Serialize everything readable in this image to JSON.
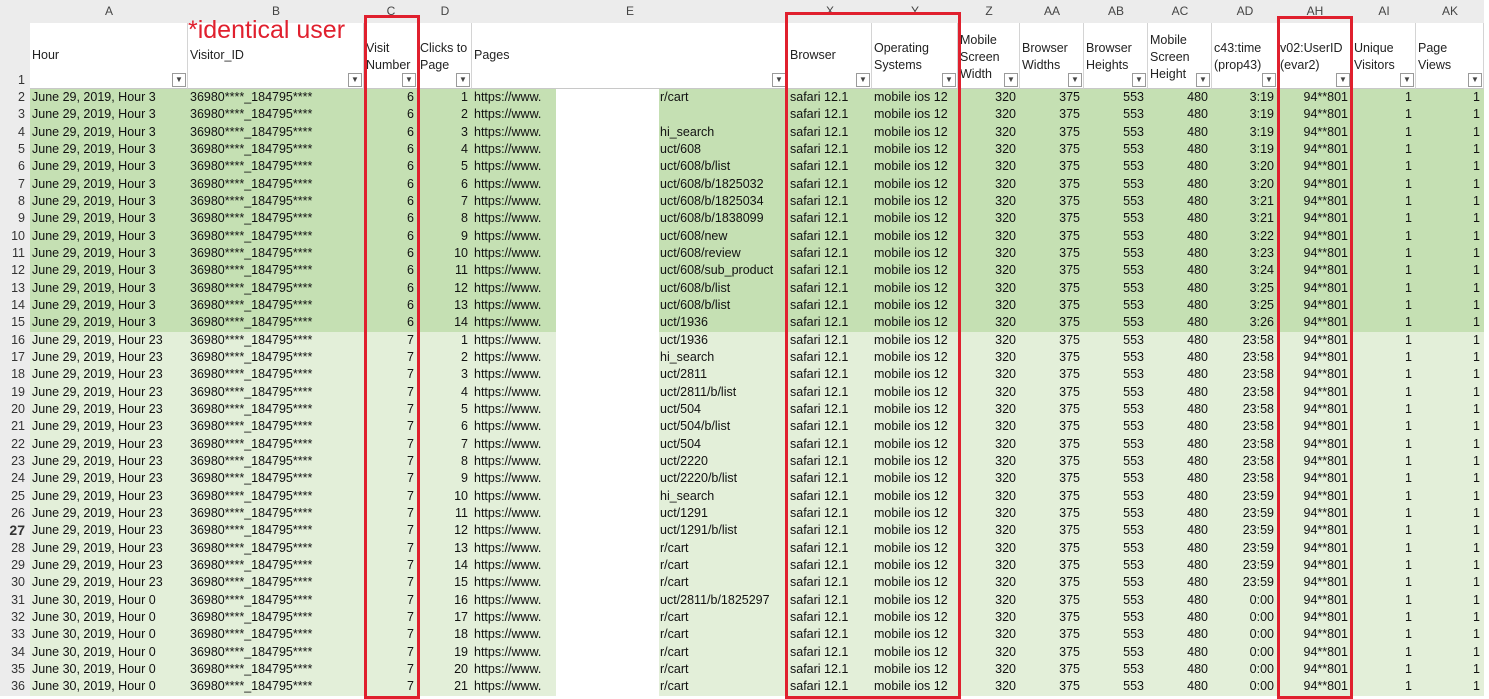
{
  "sheet": {
    "column_letters": [
      "A",
      "B",
      "C",
      "D",
      "E",
      "X",
      "Y",
      "Z",
      "AA",
      "AB",
      "AC",
      "AD",
      "AH",
      "AI",
      "AK"
    ],
    "headers": {
      "A": "Hour",
      "B": "Visitor_ID",
      "C": "Visit Number",
      "D": "Clicks to Page",
      "E": "Pages",
      "X": "Browser",
      "Y": "Operating Systems",
      "Z": "Mobile Screen Width",
      "AA": "Browser Widths",
      "AB": "Browser Heights",
      "AC": "Mobile Screen Height",
      "AD": "c43:time (prop43)",
      "AH": "v02:UserID (evar2)",
      "AI": "Unique Visitors",
      "AK": "Page Views"
    },
    "header_row_number": "1",
    "rows": [
      {
        "n": "2",
        "hour": "June 29, 2019, Hour 3",
        "visitor": "36980****_184795****",
        "visit": "6",
        "clicks": "1",
        "page_left": "https://www.",
        "page_right": "r/cart",
        "browser": "safari 12.1",
        "os": "mobile ios 12",
        "msw": "320",
        "bw": "375",
        "bh": "553",
        "msh": "480",
        "time": "3:19",
        "userid": "94**801",
        "uv": "1",
        "pv": "1"
      },
      {
        "n": "3",
        "hour": "June 29, 2019, Hour 3",
        "visitor": "36980****_184795****",
        "visit": "6",
        "clicks": "2",
        "page_left": "https://www.",
        "page_right": "",
        "browser": "safari 12.1",
        "os": "mobile ios 12",
        "msw": "320",
        "bw": "375",
        "bh": "553",
        "msh": "480",
        "time": "3:19",
        "userid": "94**801",
        "uv": "1",
        "pv": "1"
      },
      {
        "n": "4",
        "hour": "June 29, 2019, Hour 3",
        "visitor": "36980****_184795****",
        "visit": "6",
        "clicks": "3",
        "page_left": "https://www.",
        "page_right": "hi_search",
        "browser": "safari 12.1",
        "os": "mobile ios 12",
        "msw": "320",
        "bw": "375",
        "bh": "553",
        "msh": "480",
        "time": "3:19",
        "userid": "94**801",
        "uv": "1",
        "pv": "1"
      },
      {
        "n": "5",
        "hour": "June 29, 2019, Hour 3",
        "visitor": "36980****_184795****",
        "visit": "6",
        "clicks": "4",
        "page_left": "https://www.",
        "page_right": "uct/608",
        "browser": "safari 12.1",
        "os": "mobile ios 12",
        "msw": "320",
        "bw": "375",
        "bh": "553",
        "msh": "480",
        "time": "3:19",
        "userid": "94**801",
        "uv": "1",
        "pv": "1"
      },
      {
        "n": "6",
        "hour": "June 29, 2019, Hour 3",
        "visitor": "36980****_184795****",
        "visit": "6",
        "clicks": "5",
        "page_left": "https://www.",
        "page_right": "uct/608/b/list",
        "browser": "safari 12.1",
        "os": "mobile ios 12",
        "msw": "320",
        "bw": "375",
        "bh": "553",
        "msh": "480",
        "time": "3:20",
        "userid": "94**801",
        "uv": "1",
        "pv": "1"
      },
      {
        "n": "7",
        "hour": "June 29, 2019, Hour 3",
        "visitor": "36980****_184795****",
        "visit": "6",
        "clicks": "6",
        "page_left": "https://www.",
        "page_right": "uct/608/b/1825032",
        "browser": "safari 12.1",
        "os": "mobile ios 12",
        "msw": "320",
        "bw": "375",
        "bh": "553",
        "msh": "480",
        "time": "3:20",
        "userid": "94**801",
        "uv": "1",
        "pv": "1"
      },
      {
        "n": "8",
        "hour": "June 29, 2019, Hour 3",
        "visitor": "36980****_184795****",
        "visit": "6",
        "clicks": "7",
        "page_left": "https://www.",
        "page_right": "uct/608/b/1825034",
        "browser": "safari 12.1",
        "os": "mobile ios 12",
        "msw": "320",
        "bw": "375",
        "bh": "553",
        "msh": "480",
        "time": "3:21",
        "userid": "94**801",
        "uv": "1",
        "pv": "1"
      },
      {
        "n": "9",
        "hour": "June 29, 2019, Hour 3",
        "visitor": "36980****_184795****",
        "visit": "6",
        "clicks": "8",
        "page_left": "https://www.",
        "page_right": "uct/608/b/1838099",
        "browser": "safari 12.1",
        "os": "mobile ios 12",
        "msw": "320",
        "bw": "375",
        "bh": "553",
        "msh": "480",
        "time": "3:21",
        "userid": "94**801",
        "uv": "1",
        "pv": "1"
      },
      {
        "n": "10",
        "hour": "June 29, 2019, Hour 3",
        "visitor": "36980****_184795****",
        "visit": "6",
        "clicks": "9",
        "page_left": "https://www.",
        "page_right": "uct/608/new",
        "browser": "safari 12.1",
        "os": "mobile ios 12",
        "msw": "320",
        "bw": "375",
        "bh": "553",
        "msh": "480",
        "time": "3:22",
        "userid": "94**801",
        "uv": "1",
        "pv": "1"
      },
      {
        "n": "11",
        "hour": "June 29, 2019, Hour 3",
        "visitor": "36980****_184795****",
        "visit": "6",
        "clicks": "10",
        "page_left": "https://www.",
        "page_right": "uct/608/review",
        "browser": "safari 12.1",
        "os": "mobile ios 12",
        "msw": "320",
        "bw": "375",
        "bh": "553",
        "msh": "480",
        "time": "3:23",
        "userid": "94**801",
        "uv": "1",
        "pv": "1"
      },
      {
        "n": "12",
        "hour": "June 29, 2019, Hour 3",
        "visitor": "36980****_184795****",
        "visit": "6",
        "clicks": "11",
        "page_left": "https://www.",
        "page_right": "uct/608/sub_product",
        "browser": "safari 12.1",
        "os": "mobile ios 12",
        "msw": "320",
        "bw": "375",
        "bh": "553",
        "msh": "480",
        "time": "3:24",
        "userid": "94**801",
        "uv": "1",
        "pv": "1"
      },
      {
        "n": "13",
        "hour": "June 29, 2019, Hour 3",
        "visitor": "36980****_184795****",
        "visit": "6",
        "clicks": "12",
        "page_left": "https://www.",
        "page_right": "uct/608/b/list",
        "browser": "safari 12.1",
        "os": "mobile ios 12",
        "msw": "320",
        "bw": "375",
        "bh": "553",
        "msh": "480",
        "time": "3:25",
        "userid": "94**801",
        "uv": "1",
        "pv": "1"
      },
      {
        "n": "14",
        "hour": "June 29, 2019, Hour 3",
        "visitor": "36980****_184795****",
        "visit": "6",
        "clicks": "13",
        "page_left": "https://www.",
        "page_right": "uct/608/b/list",
        "browser": "safari 12.1",
        "os": "mobile ios 12",
        "msw": "320",
        "bw": "375",
        "bh": "553",
        "msh": "480",
        "time": "3:25",
        "userid": "94**801",
        "uv": "1",
        "pv": "1"
      },
      {
        "n": "15",
        "hour": "June 29, 2019, Hour 3",
        "visitor": "36980****_184795****",
        "visit": "6",
        "clicks": "14",
        "page_left": "https://www.",
        "page_right": "uct/1936",
        "browser": "safari 12.1",
        "os": "mobile ios 12",
        "msw": "320",
        "bw": "375",
        "bh": "553",
        "msh": "480",
        "time": "3:26",
        "userid": "94**801",
        "uv": "1",
        "pv": "1"
      },
      {
        "n": "16",
        "hour": "June 29, 2019, Hour 23",
        "visitor": "36980****_184795****",
        "visit": "7",
        "clicks": "1",
        "page_left": "https://www.",
        "page_right": "uct/1936",
        "browser": "safari 12.1",
        "os": "mobile ios 12",
        "msw": "320",
        "bw": "375",
        "bh": "553",
        "msh": "480",
        "time": "23:58",
        "userid": "94**801",
        "uv": "1",
        "pv": "1"
      },
      {
        "n": "17",
        "hour": "June 29, 2019, Hour 23",
        "visitor": "36980****_184795****",
        "visit": "7",
        "clicks": "2",
        "page_left": "https://www.",
        "page_right": "hi_search",
        "browser": "safari 12.1",
        "os": "mobile ios 12",
        "msw": "320",
        "bw": "375",
        "bh": "553",
        "msh": "480",
        "time": "23:58",
        "userid": "94**801",
        "uv": "1",
        "pv": "1"
      },
      {
        "n": "18",
        "hour": "June 29, 2019, Hour 23",
        "visitor": "36980****_184795****",
        "visit": "7",
        "clicks": "3",
        "page_left": "https://www.",
        "page_right": "uct/2811",
        "browser": "safari 12.1",
        "os": "mobile ios 12",
        "msw": "320",
        "bw": "375",
        "bh": "553",
        "msh": "480",
        "time": "23:58",
        "userid": "94**801",
        "uv": "1",
        "pv": "1"
      },
      {
        "n": "19",
        "hour": "June 29, 2019, Hour 23",
        "visitor": "36980****_184795****",
        "visit": "7",
        "clicks": "4",
        "page_left": "https://www.",
        "page_right": "uct/2811/b/list",
        "browser": "safari 12.1",
        "os": "mobile ios 12",
        "msw": "320",
        "bw": "375",
        "bh": "553",
        "msh": "480",
        "time": "23:58",
        "userid": "94**801",
        "uv": "1",
        "pv": "1"
      },
      {
        "n": "20",
        "hour": "June 29, 2019, Hour 23",
        "visitor": "36980****_184795****",
        "visit": "7",
        "clicks": "5",
        "page_left": "https://www.",
        "page_right": "uct/504",
        "browser": "safari 12.1",
        "os": "mobile ios 12",
        "msw": "320",
        "bw": "375",
        "bh": "553",
        "msh": "480",
        "time": "23:58",
        "userid": "94**801",
        "uv": "1",
        "pv": "1"
      },
      {
        "n": "21",
        "hour": "June 29, 2019, Hour 23",
        "visitor": "36980****_184795****",
        "visit": "7",
        "clicks": "6",
        "page_left": "https://www.",
        "page_right": "uct/504/b/list",
        "browser": "safari 12.1",
        "os": "mobile ios 12",
        "msw": "320",
        "bw": "375",
        "bh": "553",
        "msh": "480",
        "time": "23:58",
        "userid": "94**801",
        "uv": "1",
        "pv": "1"
      },
      {
        "n": "22",
        "hour": "June 29, 2019, Hour 23",
        "visitor": "36980****_184795****",
        "visit": "7",
        "clicks": "7",
        "page_left": "https://www.",
        "page_right": "uct/504",
        "browser": "safari 12.1",
        "os": "mobile ios 12",
        "msw": "320",
        "bw": "375",
        "bh": "553",
        "msh": "480",
        "time": "23:58",
        "userid": "94**801",
        "uv": "1",
        "pv": "1"
      },
      {
        "n": "23",
        "hour": "June 29, 2019, Hour 23",
        "visitor": "36980****_184795****",
        "visit": "7",
        "clicks": "8",
        "page_left": "https://www.",
        "page_right": "uct/2220",
        "browser": "safari 12.1",
        "os": "mobile ios 12",
        "msw": "320",
        "bw": "375",
        "bh": "553",
        "msh": "480",
        "time": "23:58",
        "userid": "94**801",
        "uv": "1",
        "pv": "1"
      },
      {
        "n": "24",
        "hour": "June 29, 2019, Hour 23",
        "visitor": "36980****_184795****",
        "visit": "7",
        "clicks": "9",
        "page_left": "https://www.",
        "page_right": "uct/2220/b/list",
        "browser": "safari 12.1",
        "os": "mobile ios 12",
        "msw": "320",
        "bw": "375",
        "bh": "553",
        "msh": "480",
        "time": "23:58",
        "userid": "94**801",
        "uv": "1",
        "pv": "1"
      },
      {
        "n": "25",
        "hour": "June 29, 2019, Hour 23",
        "visitor": "36980****_184795****",
        "visit": "7",
        "clicks": "10",
        "page_left": "https://www.",
        "page_right": "hi_search",
        "browser": "safari 12.1",
        "os": "mobile ios 12",
        "msw": "320",
        "bw": "375",
        "bh": "553",
        "msh": "480",
        "time": "23:59",
        "userid": "94**801",
        "uv": "1",
        "pv": "1"
      },
      {
        "n": "26",
        "hour": "June 29, 2019, Hour 23",
        "visitor": "36980****_184795****",
        "visit": "7",
        "clicks": "11",
        "page_left": "https://www.",
        "page_right": "uct/1291",
        "browser": "safari 12.1",
        "os": "mobile ios 12",
        "msw": "320",
        "bw": "375",
        "bh": "553",
        "msh": "480",
        "time": "23:59",
        "userid": "94**801",
        "uv": "1",
        "pv": "1"
      },
      {
        "n": "27",
        "hour": "June 29, 2019, Hour 23",
        "visitor": "36980****_184795****",
        "visit": "7",
        "clicks": "12",
        "page_left": "https://www.",
        "page_right": "uct/1291/b/list",
        "browser": "safari 12.1",
        "os": "mobile ios 12",
        "msw": "320",
        "bw": "375",
        "bh": "553",
        "msh": "480",
        "time": "23:59",
        "userid": "94**801",
        "uv": "1",
        "pv": "1"
      },
      {
        "n": "28",
        "hour": "June 29, 2019, Hour 23",
        "visitor": "36980****_184795****",
        "visit": "7",
        "clicks": "13",
        "page_left": "https://www.",
        "page_right": "r/cart",
        "browser": "safari 12.1",
        "os": "mobile ios 12",
        "msw": "320",
        "bw": "375",
        "bh": "553",
        "msh": "480",
        "time": "23:59",
        "userid": "94**801",
        "uv": "1",
        "pv": "1"
      },
      {
        "n": "29",
        "hour": "June 29, 2019, Hour 23",
        "visitor": "36980****_184795****",
        "visit": "7",
        "clicks": "14",
        "page_left": "https://www.",
        "page_right": "r/cart",
        "browser": "safari 12.1",
        "os": "mobile ios 12",
        "msw": "320",
        "bw": "375",
        "bh": "553",
        "msh": "480",
        "time": "23:59",
        "userid": "94**801",
        "uv": "1",
        "pv": "1"
      },
      {
        "n": "30",
        "hour": "June 29, 2019, Hour 23",
        "visitor": "36980****_184795****",
        "visit": "7",
        "clicks": "15",
        "page_left": "https://www.",
        "page_right": "r/cart",
        "browser": "safari 12.1",
        "os": "mobile ios 12",
        "msw": "320",
        "bw": "375",
        "bh": "553",
        "msh": "480",
        "time": "23:59",
        "userid": "94**801",
        "uv": "1",
        "pv": "1"
      },
      {
        "n": "31",
        "hour": "June 30, 2019, Hour 0",
        "visitor": "36980****_184795****",
        "visit": "7",
        "clicks": "16",
        "page_left": "https://www.",
        "page_right": "uct/2811/b/1825297",
        "browser": "safari 12.1",
        "os": "mobile ios 12",
        "msw": "320",
        "bw": "375",
        "bh": "553",
        "msh": "480",
        "time": "0:00",
        "userid": "94**801",
        "uv": "1",
        "pv": "1"
      },
      {
        "n": "32",
        "hour": "June 30, 2019, Hour 0",
        "visitor": "36980****_184795****",
        "visit": "7",
        "clicks": "17",
        "page_left": "https://www.",
        "page_right": "r/cart",
        "browser": "safari 12.1",
        "os": "mobile ios 12",
        "msw": "320",
        "bw": "375",
        "bh": "553",
        "msh": "480",
        "time": "0:00",
        "userid": "94**801",
        "uv": "1",
        "pv": "1"
      },
      {
        "n": "33",
        "hour": "June 30, 2019, Hour 0",
        "visitor": "36980****_184795****",
        "visit": "7",
        "clicks": "18",
        "page_left": "https://www.",
        "page_right": "r/cart",
        "browser": "safari 12.1",
        "os": "mobile ios 12",
        "msw": "320",
        "bw": "375",
        "bh": "553",
        "msh": "480",
        "time": "0:00",
        "userid": "94**801",
        "uv": "1",
        "pv": "1"
      },
      {
        "n": "34",
        "hour": "June 30, 2019, Hour 0",
        "visitor": "36980****_184795****",
        "visit": "7",
        "clicks": "19",
        "page_left": "https://www.",
        "page_right": "r/cart",
        "browser": "safari 12.1",
        "os": "mobile ios 12",
        "msw": "320",
        "bw": "375",
        "bh": "553",
        "msh": "480",
        "time": "0:00",
        "userid": "94**801",
        "uv": "1",
        "pv": "1"
      },
      {
        "n": "35",
        "hour": "June 30, 2019, Hour 0",
        "visitor": "36980****_184795****",
        "visit": "7",
        "clicks": "20",
        "page_left": "https://www.",
        "page_right": "r/cart",
        "browser": "safari 12.1",
        "os": "mobile ios 12",
        "msw": "320",
        "bw": "375",
        "bh": "553",
        "msh": "480",
        "time": "0:00",
        "userid": "94**801",
        "uv": "1",
        "pv": "1"
      },
      {
        "n": "36",
        "hour": "June 30, 2019, Hour 0",
        "visitor": "36980****_184795****",
        "visit": "7",
        "clicks": "21",
        "page_left": "https://www.",
        "page_right": "r/cart",
        "browser": "safari 12.1",
        "os": "mobile ios 12",
        "msw": "320",
        "bw": "375",
        "bh": "553",
        "msh": "480",
        "time": "0:00",
        "userid": "94**801",
        "uv": "1",
        "pv": "1"
      }
    ],
    "active_row": "27"
  },
  "annotation": {
    "label": "*identical user",
    "color": "#e0202e"
  }
}
